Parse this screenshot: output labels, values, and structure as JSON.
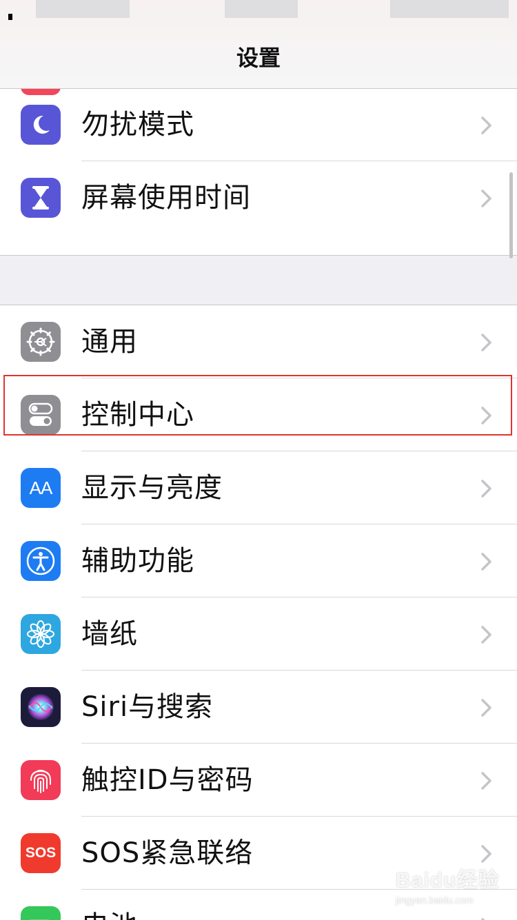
{
  "nav": {
    "title": "设置"
  },
  "group1": [
    {
      "label": "勿扰模式",
      "icon": "moon-icon",
      "color": "#5856d6"
    },
    {
      "label": "屏幕使用时间",
      "icon": "hourglass-icon",
      "color": "#5856d6"
    }
  ],
  "group2": [
    {
      "label": "通用",
      "icon": "gear-icon",
      "color": "#8e8e93"
    },
    {
      "label": "控制中心",
      "icon": "toggles-icon",
      "color": "#8e8e93"
    },
    {
      "label": "显示与亮度",
      "icon": "text-size-icon",
      "color": "#1e7cf2",
      "icon_text": "AA"
    },
    {
      "label": "辅助功能",
      "icon": "accessibility-icon",
      "color": "#1e7cf2"
    },
    {
      "label": "墙纸",
      "icon": "flower-icon",
      "color": "#2ea7e0"
    },
    {
      "label": "Siri与搜索",
      "icon": "siri-icon",
      "color": "#1c1c3a"
    },
    {
      "label": "触控ID与密码",
      "icon": "fingerprint-icon",
      "color": "#f23b58"
    },
    {
      "label": "SOS紧急联络",
      "icon": "sos-icon",
      "color": "#f03a2e",
      "icon_text": "SOS"
    },
    {
      "label": "电池",
      "icon": "battery-icon",
      "color": "#34c759"
    }
  ],
  "watermark": {
    "main": "Baidu经验",
    "sub": "jingyan.baidu.com"
  }
}
